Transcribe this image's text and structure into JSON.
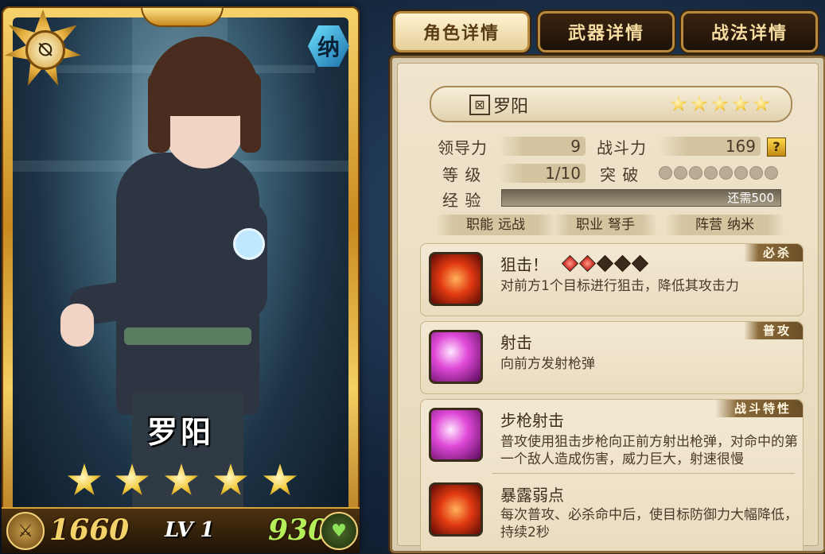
{
  "card": {
    "name": "罗阳",
    "faction_glyph": "纳",
    "rank_glyph": "⍉",
    "stars": 5,
    "attack": "1660",
    "level": "LV 1",
    "hp": "930",
    "left_icon": "sword-icon",
    "right_icon": "heart-icon"
  },
  "tabs": [
    {
      "label": "角色详情",
      "active": true
    },
    {
      "label": "武器详情",
      "active": false
    },
    {
      "label": "战法详情",
      "active": false
    }
  ],
  "details": {
    "name": "罗阳",
    "stars": 5,
    "stats": {
      "leadership_label": "领导力",
      "leadership": "9",
      "power_label": "战斗力",
      "power": "169",
      "help": "?",
      "level_label": "等 级",
      "level": "1/10",
      "break_label": "突 破",
      "break_total": 8,
      "exp_label": "经 验",
      "exp_fill": 0,
      "exp_text": "还需500"
    },
    "tags": [
      {
        "label": "职能",
        "value": "远战"
      },
      {
        "label": "职业",
        "value": "弩手"
      },
      {
        "label": "阵营",
        "value": "纳米"
      }
    ]
  },
  "skills": [
    {
      "name": "狙击！",
      "type": "必杀",
      "desc": "对前方1个目标进行狙击，降低其攻击力",
      "gems_total": 5,
      "gems_on": 2,
      "icon": "sniper-shot-icon"
    },
    {
      "name": "射击",
      "type": "普攻",
      "desc": "向前方发射枪弹",
      "icon": "shoot-icon"
    },
    {
      "name": "步枪射击",
      "type": "战斗特性",
      "desc": "普攻使用狙击步枪向正前方射出枪弹，对命中的第一个敌人造成伤害，威力巨大，射速很慢",
      "icon": "rifle-shot-icon"
    },
    {
      "name": "暴露弱点",
      "desc": "每次普攻、必杀命中后，使目标防御力大幅降低，持续2秒",
      "icon": "expose-weakness-icon"
    }
  ],
  "colors": {
    "gold": "#e6b040",
    "panel": "#efe4cc",
    "tab_dark": "#2a180a",
    "exp_bar": "#8a8068"
  }
}
